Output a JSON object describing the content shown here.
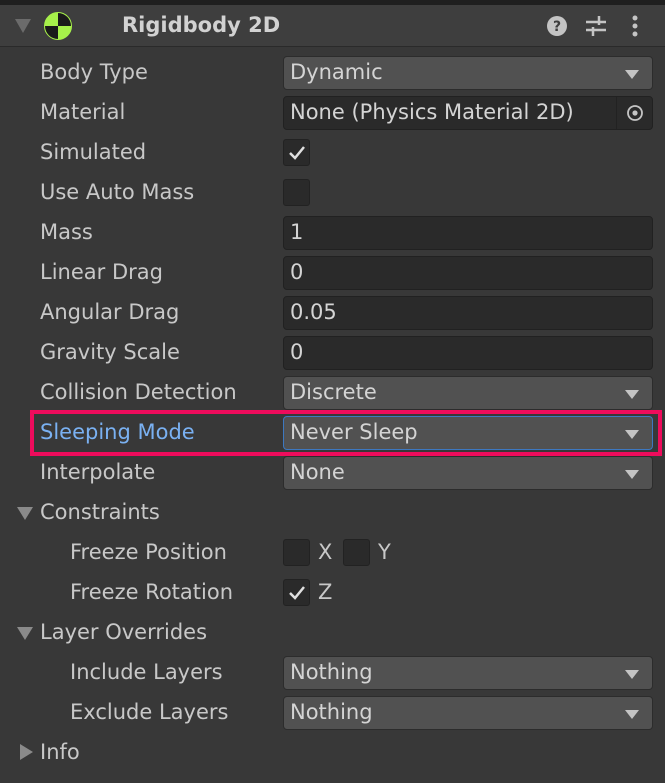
{
  "component": {
    "title": "Rigidbody 2D",
    "icons": [
      "help-icon",
      "presets-icon",
      "more-icon"
    ]
  },
  "fields": {
    "body_type": {
      "label": "Body Type",
      "value": "Dynamic"
    },
    "material": {
      "label": "Material",
      "value": "None (Physics Material 2D)"
    },
    "simulated": {
      "label": "Simulated",
      "checked": true
    },
    "use_auto_mass": {
      "label": "Use Auto Mass",
      "checked": false
    },
    "mass": {
      "label": "Mass",
      "value": "1"
    },
    "linear_drag": {
      "label": "Linear Drag",
      "value": "0"
    },
    "angular_drag": {
      "label": "Angular Drag",
      "value": "0.05"
    },
    "gravity_scale": {
      "label": "Gravity Scale",
      "value": "0"
    },
    "collision_detection": {
      "label": "Collision Detection",
      "value": "Discrete"
    },
    "sleeping_mode": {
      "label": "Sleeping Mode",
      "value": "Never Sleep"
    },
    "interpolate": {
      "label": "Interpolate",
      "value": "None"
    }
  },
  "constraints": {
    "label": "Constraints",
    "freeze_position": {
      "label": "Freeze Position",
      "x": "X",
      "y": "Y",
      "x_checked": false,
      "y_checked": false
    },
    "freeze_rotation": {
      "label": "Freeze Rotation",
      "z": "Z",
      "z_checked": true
    }
  },
  "layer_overrides": {
    "label": "Layer Overrides",
    "include": {
      "label": "Include Layers",
      "value": "Nothing"
    },
    "exclude": {
      "label": "Exclude Layers",
      "value": "Nothing"
    }
  },
  "info": {
    "label": "Info"
  },
  "colors": {
    "highlight": "#ee0c5c",
    "label_focus": "#7ab1f2",
    "icon_green": "#a6f04a"
  }
}
